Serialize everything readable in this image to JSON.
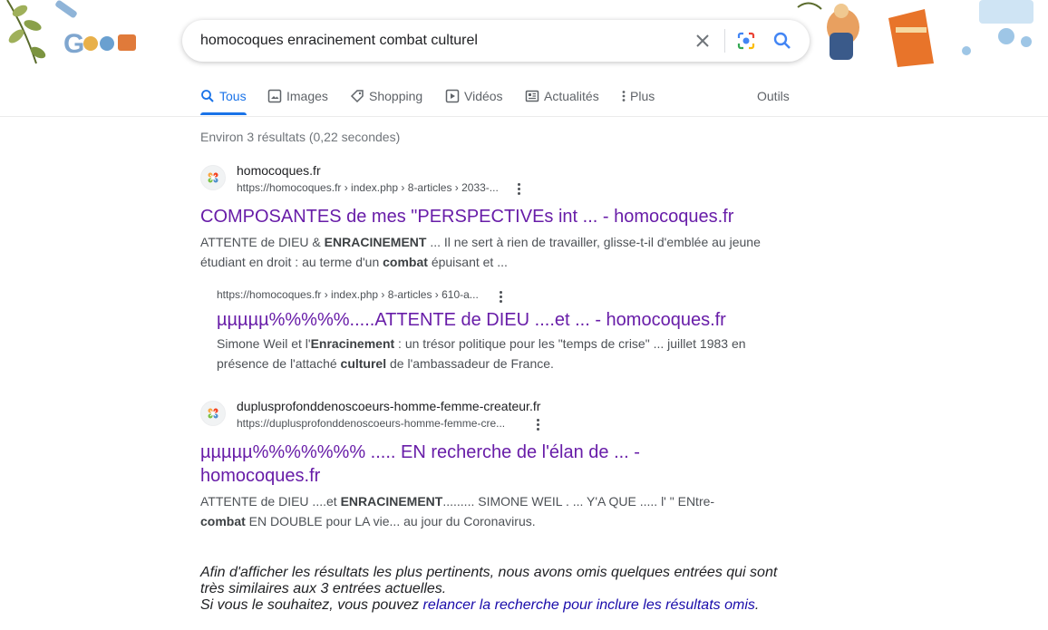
{
  "search": {
    "query": "homocoques enracinement combat culturel"
  },
  "tabs": [
    {
      "label": "Tous",
      "icon": "search-icon"
    },
    {
      "label": "Images",
      "icon": "image-icon"
    },
    {
      "label": "Shopping",
      "icon": "tag-icon"
    },
    {
      "label": "Vidéos",
      "icon": "play-icon"
    },
    {
      "label": "Actualités",
      "icon": "news-icon"
    },
    {
      "label": "Plus",
      "icon": "more-vert-icon"
    },
    {
      "label": "Outils"
    }
  ],
  "stats": "Environ 3 résultats (0,22 secondes)",
  "results": [
    {
      "site": "homocoques.fr",
      "url": "https://homocoques.fr › index.php › 8-articles › 2033-...",
      "title": "COMPOSANTES de mes \"PERSPECTIVEs int ... - homocoques.fr",
      "snippet": [
        {
          "t": "ATTENTE de DIEU & "
        },
        {
          "t": "ENRACINEMENT",
          "b": true
        },
        {
          "t": " ... Il ne sert à rien de travailler, glisse-t-il d'emblée au jeune étudiant en droit : au terme d'un "
        },
        {
          "t": "combat",
          "b": true
        },
        {
          "t": " épuisant et ..."
        }
      ]
    },
    {
      "url": "https://homocoques.fr › index.php › 8-articles › 610-a...",
      "title": "µµµµµ%%%%%.....ATTENTE de DIEU ....et ... - homocoques.fr",
      "snippet": [
        {
          "t": "Simone Weil et l'"
        },
        {
          "t": "Enracinement",
          "b": true
        },
        {
          "t": " : un trésor politique pour les \"temps de crise\" ... juillet 1983 en présence de l'attaché "
        },
        {
          "t": "culturel",
          "b": true
        },
        {
          "t": " de l'ambassadeur de France."
        }
      ]
    },
    {
      "site": "duplusprofonddenoscoeurs-homme-femme-createur.fr",
      "url": "https://duplusprofonddenoscoeurs-homme-femme-cre...",
      "title": "µµµµµ%%%%%%% ..... EN recherche de l'élan de ... - homocoques.fr",
      "snippet": [
        {
          "t": "ATTENTE de DIEU ....et "
        },
        {
          "t": "ENRACINEMENT",
          "b": true
        },
        {
          "t": "......... SIMONE WEIL . ... Y'A QUE ..... l' \" ENtre-"
        },
        {
          "t": "combat",
          "b": true
        },
        {
          "t": " EN DOUBLE pour LA vie... au jour du Coronavirus."
        }
      ]
    }
  ],
  "omitted": {
    "text1": "Afin d'afficher les résultats les plus pertinents, nous avons omis quelques entrées qui sont très similaires aux 3 entrées actuelles.",
    "text2": "Si vous le souhaitez, vous pouvez ",
    "link": "relancer la recherche pour inclure les résultats omis",
    "end": "."
  },
  "colors": {
    "accent": "#1a73e8",
    "visited_title": "#681da8",
    "link": "#1a0dab"
  }
}
